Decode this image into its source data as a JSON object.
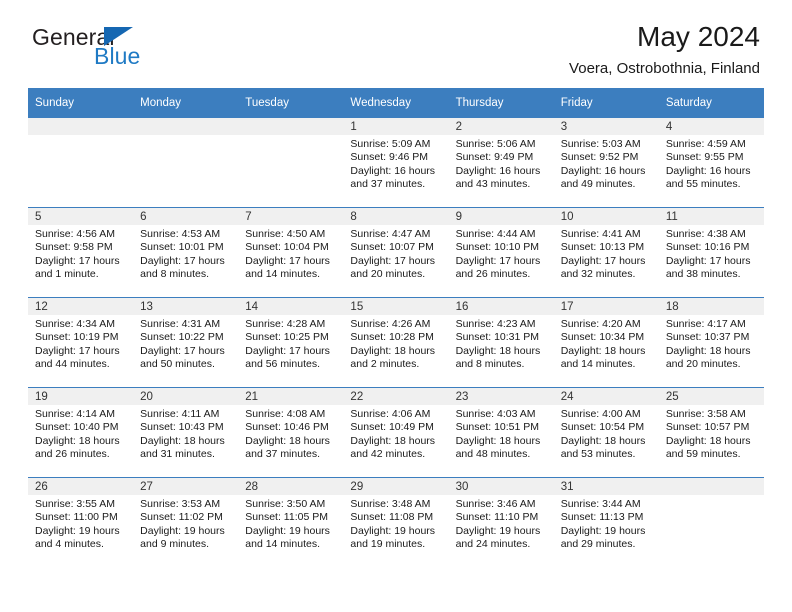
{
  "brand": {
    "name_part1": "General",
    "name_part2": "Blue",
    "triangle_color": "#1567b2",
    "blue_color": "#1f7ac4"
  },
  "header": {
    "title": "May 2024",
    "subtitle": "Voera, Ostrobothnia, Finland"
  },
  "theme": {
    "header_bg": "#3c7ebf",
    "header_text": "#ffffff",
    "daynum_band_bg": "#f0f0f0",
    "row_border": "#3c7ebf",
    "cell_bg": "#ffffff"
  },
  "weekday_headers": [
    "Sunday",
    "Monday",
    "Tuesday",
    "Wednesday",
    "Thursday",
    "Friday",
    "Saturday"
  ],
  "weeks": [
    [
      {
        "day": "",
        "empty": true,
        "sunrise": "",
        "sunset": "",
        "daylight_line1": "",
        "daylight_line2": ""
      },
      {
        "day": "",
        "empty": true,
        "sunrise": "",
        "sunset": "",
        "daylight_line1": "",
        "daylight_line2": ""
      },
      {
        "day": "",
        "empty": true,
        "sunrise": "",
        "sunset": "",
        "daylight_line1": "",
        "daylight_line2": ""
      },
      {
        "day": "1",
        "empty": false,
        "sunrise": "Sunrise: 5:09 AM",
        "sunset": "Sunset: 9:46 PM",
        "daylight_line1": "Daylight: 16 hours",
        "daylight_line2": "and 37 minutes."
      },
      {
        "day": "2",
        "empty": false,
        "sunrise": "Sunrise: 5:06 AM",
        "sunset": "Sunset: 9:49 PM",
        "daylight_line1": "Daylight: 16 hours",
        "daylight_line2": "and 43 minutes."
      },
      {
        "day": "3",
        "empty": false,
        "sunrise": "Sunrise: 5:03 AM",
        "sunset": "Sunset: 9:52 PM",
        "daylight_line1": "Daylight: 16 hours",
        "daylight_line2": "and 49 minutes."
      },
      {
        "day": "4",
        "empty": false,
        "sunrise": "Sunrise: 4:59 AM",
        "sunset": "Sunset: 9:55 PM",
        "daylight_line1": "Daylight: 16 hours",
        "daylight_line2": "and 55 minutes."
      }
    ],
    [
      {
        "day": "5",
        "empty": false,
        "sunrise": "Sunrise: 4:56 AM",
        "sunset": "Sunset: 9:58 PM",
        "daylight_line1": "Daylight: 17 hours",
        "daylight_line2": "and 1 minute."
      },
      {
        "day": "6",
        "empty": false,
        "sunrise": "Sunrise: 4:53 AM",
        "sunset": "Sunset: 10:01 PM",
        "daylight_line1": "Daylight: 17 hours",
        "daylight_line2": "and 8 minutes."
      },
      {
        "day": "7",
        "empty": false,
        "sunrise": "Sunrise: 4:50 AM",
        "sunset": "Sunset: 10:04 PM",
        "daylight_line1": "Daylight: 17 hours",
        "daylight_line2": "and 14 minutes."
      },
      {
        "day": "8",
        "empty": false,
        "sunrise": "Sunrise: 4:47 AM",
        "sunset": "Sunset: 10:07 PM",
        "daylight_line1": "Daylight: 17 hours",
        "daylight_line2": "and 20 minutes."
      },
      {
        "day": "9",
        "empty": false,
        "sunrise": "Sunrise: 4:44 AM",
        "sunset": "Sunset: 10:10 PM",
        "daylight_line1": "Daylight: 17 hours",
        "daylight_line2": "and 26 minutes."
      },
      {
        "day": "10",
        "empty": false,
        "sunrise": "Sunrise: 4:41 AM",
        "sunset": "Sunset: 10:13 PM",
        "daylight_line1": "Daylight: 17 hours",
        "daylight_line2": "and 32 minutes."
      },
      {
        "day": "11",
        "empty": false,
        "sunrise": "Sunrise: 4:38 AM",
        "sunset": "Sunset: 10:16 PM",
        "daylight_line1": "Daylight: 17 hours",
        "daylight_line2": "and 38 minutes."
      }
    ],
    [
      {
        "day": "12",
        "empty": false,
        "sunrise": "Sunrise: 4:34 AM",
        "sunset": "Sunset: 10:19 PM",
        "daylight_line1": "Daylight: 17 hours",
        "daylight_line2": "and 44 minutes."
      },
      {
        "day": "13",
        "empty": false,
        "sunrise": "Sunrise: 4:31 AM",
        "sunset": "Sunset: 10:22 PM",
        "daylight_line1": "Daylight: 17 hours",
        "daylight_line2": "and 50 minutes."
      },
      {
        "day": "14",
        "empty": false,
        "sunrise": "Sunrise: 4:28 AM",
        "sunset": "Sunset: 10:25 PM",
        "daylight_line1": "Daylight: 17 hours",
        "daylight_line2": "and 56 minutes."
      },
      {
        "day": "15",
        "empty": false,
        "sunrise": "Sunrise: 4:26 AM",
        "sunset": "Sunset: 10:28 PM",
        "daylight_line1": "Daylight: 18 hours",
        "daylight_line2": "and 2 minutes."
      },
      {
        "day": "16",
        "empty": false,
        "sunrise": "Sunrise: 4:23 AM",
        "sunset": "Sunset: 10:31 PM",
        "daylight_line1": "Daylight: 18 hours",
        "daylight_line2": "and 8 minutes."
      },
      {
        "day": "17",
        "empty": false,
        "sunrise": "Sunrise: 4:20 AM",
        "sunset": "Sunset: 10:34 PM",
        "daylight_line1": "Daylight: 18 hours",
        "daylight_line2": "and 14 minutes."
      },
      {
        "day": "18",
        "empty": false,
        "sunrise": "Sunrise: 4:17 AM",
        "sunset": "Sunset: 10:37 PM",
        "daylight_line1": "Daylight: 18 hours",
        "daylight_line2": "and 20 minutes."
      }
    ],
    [
      {
        "day": "19",
        "empty": false,
        "sunrise": "Sunrise: 4:14 AM",
        "sunset": "Sunset: 10:40 PM",
        "daylight_line1": "Daylight: 18 hours",
        "daylight_line2": "and 26 minutes."
      },
      {
        "day": "20",
        "empty": false,
        "sunrise": "Sunrise: 4:11 AM",
        "sunset": "Sunset: 10:43 PM",
        "daylight_line1": "Daylight: 18 hours",
        "daylight_line2": "and 31 minutes."
      },
      {
        "day": "21",
        "empty": false,
        "sunrise": "Sunrise: 4:08 AM",
        "sunset": "Sunset: 10:46 PM",
        "daylight_line1": "Daylight: 18 hours",
        "daylight_line2": "and 37 minutes."
      },
      {
        "day": "22",
        "empty": false,
        "sunrise": "Sunrise: 4:06 AM",
        "sunset": "Sunset: 10:49 PM",
        "daylight_line1": "Daylight: 18 hours",
        "daylight_line2": "and 42 minutes."
      },
      {
        "day": "23",
        "empty": false,
        "sunrise": "Sunrise: 4:03 AM",
        "sunset": "Sunset: 10:51 PM",
        "daylight_line1": "Daylight: 18 hours",
        "daylight_line2": "and 48 minutes."
      },
      {
        "day": "24",
        "empty": false,
        "sunrise": "Sunrise: 4:00 AM",
        "sunset": "Sunset: 10:54 PM",
        "daylight_line1": "Daylight: 18 hours",
        "daylight_line2": "and 53 minutes."
      },
      {
        "day": "25",
        "empty": false,
        "sunrise": "Sunrise: 3:58 AM",
        "sunset": "Sunset: 10:57 PM",
        "daylight_line1": "Daylight: 18 hours",
        "daylight_line2": "and 59 minutes."
      }
    ],
    [
      {
        "day": "26",
        "empty": false,
        "sunrise": "Sunrise: 3:55 AM",
        "sunset": "Sunset: 11:00 PM",
        "daylight_line1": "Daylight: 19 hours",
        "daylight_line2": "and 4 minutes."
      },
      {
        "day": "27",
        "empty": false,
        "sunrise": "Sunrise: 3:53 AM",
        "sunset": "Sunset: 11:02 PM",
        "daylight_line1": "Daylight: 19 hours",
        "daylight_line2": "and 9 minutes."
      },
      {
        "day": "28",
        "empty": false,
        "sunrise": "Sunrise: 3:50 AM",
        "sunset": "Sunset: 11:05 PM",
        "daylight_line1": "Daylight: 19 hours",
        "daylight_line2": "and 14 minutes."
      },
      {
        "day": "29",
        "empty": false,
        "sunrise": "Sunrise: 3:48 AM",
        "sunset": "Sunset: 11:08 PM",
        "daylight_line1": "Daylight: 19 hours",
        "daylight_line2": "and 19 minutes."
      },
      {
        "day": "30",
        "empty": false,
        "sunrise": "Sunrise: 3:46 AM",
        "sunset": "Sunset: 11:10 PM",
        "daylight_line1": "Daylight: 19 hours",
        "daylight_line2": "and 24 minutes."
      },
      {
        "day": "31",
        "empty": false,
        "sunrise": "Sunrise: 3:44 AM",
        "sunset": "Sunset: 11:13 PM",
        "daylight_line1": "Daylight: 19 hours",
        "daylight_line2": "and 29 minutes."
      },
      {
        "day": "",
        "empty": true,
        "sunrise": "",
        "sunset": "",
        "daylight_line1": "",
        "daylight_line2": ""
      }
    ]
  ]
}
